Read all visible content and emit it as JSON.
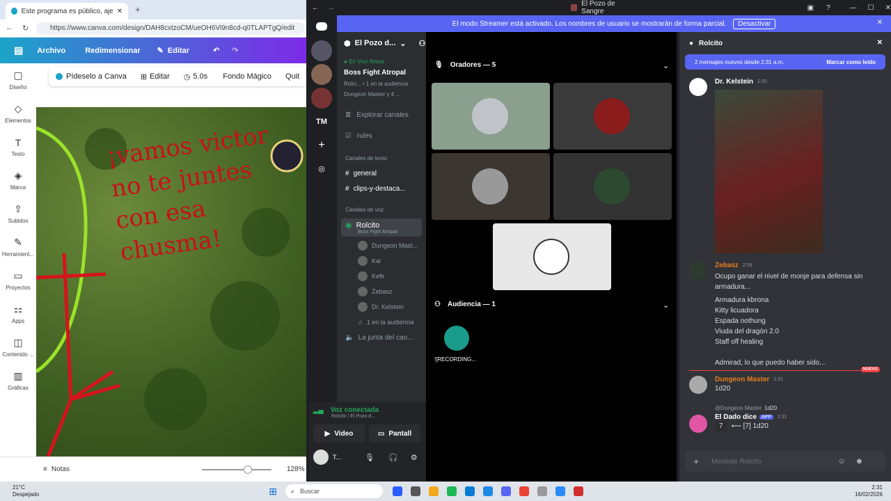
{
  "browser": {
    "tab_title": "Este programa es público, ajeno a",
    "url": "https://www.canva.com/design/DAH8cxtzoCM/ueOH6Vi9n8cd-q0TLAPTgQ/edit"
  },
  "canva": {
    "header": {
      "file": "Archivo",
      "resize": "Redimensionar",
      "edit": "Editar"
    },
    "toolbar": {
      "ask": "Pídeselo a Canva",
      "edit": "Editar",
      "duration": "5.0s",
      "magic_bg": "Fondo Mágico",
      "remove": "Quit"
    },
    "sidebar": [
      "Diseño",
      "Elementos",
      "Texto",
      "Marca",
      "Subidos",
      "Herramient...",
      "Proyectos",
      "Apps",
      "Contenido ...",
      "Gráficas"
    ],
    "footer": {
      "notes": "Notas",
      "zoom": "128%"
    },
    "handwriting": "¡vamos victor no te juntes con esa chusma!"
  },
  "discord": {
    "window_title": "El Pozo de Sangre",
    "banner": {
      "text": "El modo Streamer está activado. Los nombres de usuario se mostrarán de forma parcial.",
      "button": "Desactivar"
    },
    "server": {
      "name": "El Pozo d...",
      "live_label": "En Vivo Ahora",
      "live_title": "Boss Fight Atropal",
      "live_sub1": "Rolci...",
      "live_sub1b": "1 en la audiencia",
      "live_sub2": "Dungeon Master y 4 ..."
    },
    "channels": {
      "explore": "Explorar canales",
      "rules": "rules",
      "text_header": "Canales de texto",
      "general": "general",
      "clips": "clips-y-destaca...",
      "voice_header": "Canales de voz",
      "voice_active": "Rolcito",
      "voice_active_sub": "Boss Fight Atropal",
      "voice_users": [
        "Dungeon Mast...",
        "Kai",
        "Kefir",
        "Zebasz",
        "Dr. Kelstein"
      ],
      "audience": "1 en la audiencia",
      "other_voice": "La junta del cao..."
    },
    "voice_panel": {
      "status": "Voz conectada",
      "sub": "Rolcito / El Pozo d...",
      "video": "Video",
      "screen": "Pantall",
      "user": "T..."
    },
    "stage": {
      "speakers": "Oradores — 5",
      "audience": "Audiencia — 1",
      "audience_user": "![RECORDING..."
    },
    "chat": {
      "channel": "Rolcito",
      "new_msgs": "2 mensajes nuevos desde 2:31 a.m.",
      "mark_read": "Marcar como leído",
      "msg1": {
        "name": "Dr. Kelstein",
        "time": "2:20"
      },
      "msg2": {
        "name": "Zebasz",
        "time": "2:26",
        "lines": [
          "Ocupo ganar el nivel de monje para defensa sin armadura...",
          "Armadura kbrona",
          "Kitty licuadora",
          "Espada nothung",
          "Viuda del dragón 2.0",
          "Staff off healing",
          "",
          "Admirad, lo que puedo haber sido..."
        ]
      },
      "new_badge": "NUEVO",
      "msg3": {
        "name": "Dungeon Master",
        "time": "2:31",
        "text": "1d20"
      },
      "msg4": {
        "reply": "@Dungeon Master",
        "reply_text": "1d20",
        "name": "El Dado dice",
        "app": "APP",
        "time": "2:31",
        "roll": "7",
        "result": "⟵ [7] 1d20"
      },
      "input_placeholder": "Mensaje Rolcito"
    }
  },
  "taskbar": {
    "temp": "21°C",
    "weather": "Despejado",
    "search": "Buscar",
    "time": "2:31",
    "date": "16/02/2026"
  }
}
